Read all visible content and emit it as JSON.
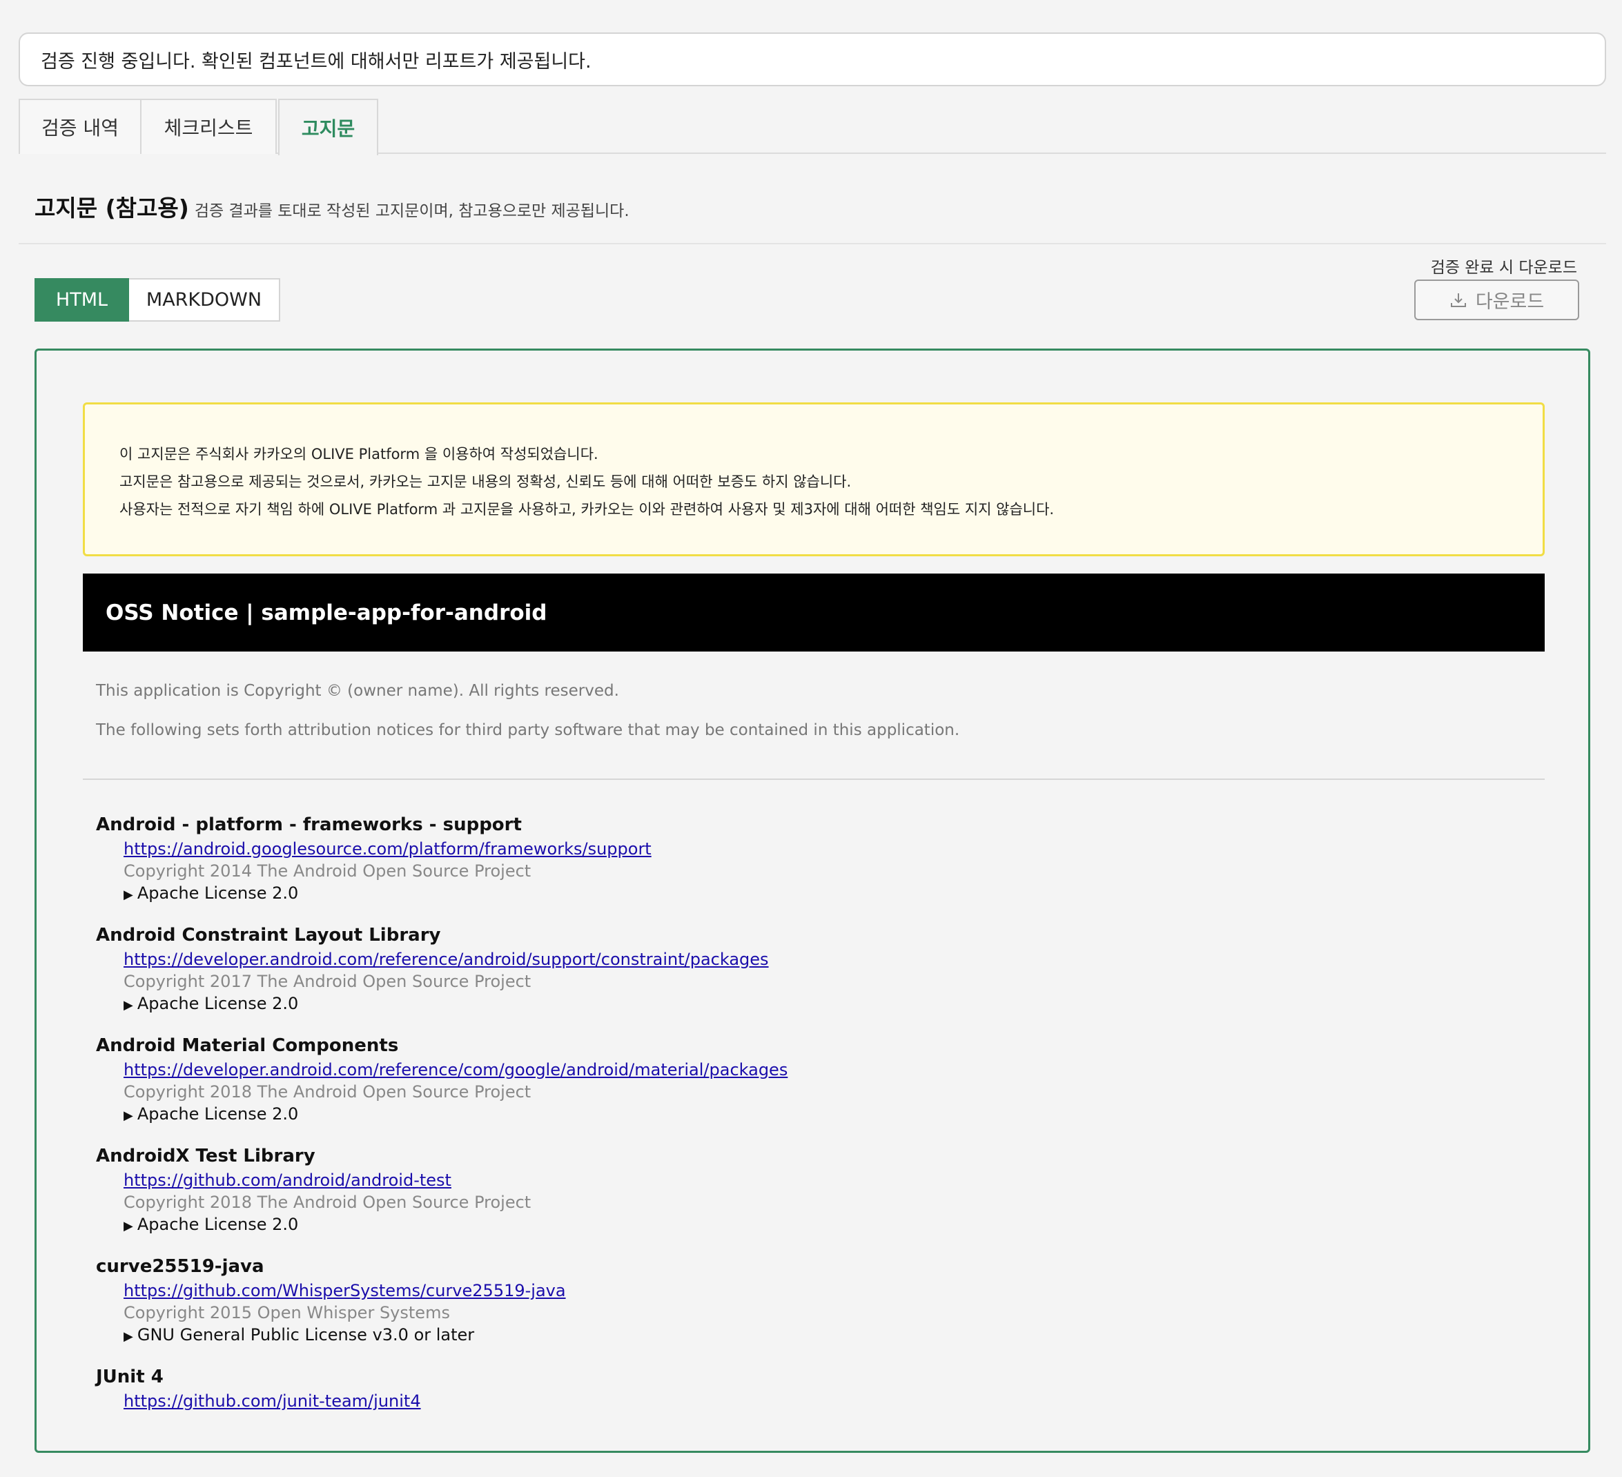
{
  "status": {
    "message": "검증 진행 중입니다. 확인된 컴포넌트에 대해서만 리포트가 제공됩니다."
  },
  "tabs": [
    {
      "label": "검증 내역"
    },
    {
      "label": "체크리스트"
    },
    {
      "label": "고지문",
      "active": true
    }
  ],
  "section": {
    "title": "고지문 (참고용)",
    "subtitle": "검증 결과를 토대로 작성된 고지문이며, 참고용으로만 제공됩니다."
  },
  "format": {
    "html_label": "HTML",
    "markdown_label": "MARKDOWN",
    "selected": "HTML"
  },
  "download": {
    "hint": "검증 완료 시 다운로드",
    "label": "다운로드",
    "icon": "download-icon"
  },
  "colors": {
    "accent": "#368a60",
    "link": "#1a0dab",
    "disclaimer_border": "#f1dd45",
    "banner_bg": "#000000"
  },
  "notice": {
    "disclaimer": [
      "이 고지문은 주식회사 카카오의 OLIVE Platform 을 이용하여 작성되었습니다.",
      "고지문은 참고용으로 제공되는 것으로서, 카카오는 고지문 내용의 정확성, 신뢰도 등에 대해 어떠한 보증도 하지 않습니다.",
      "사용자는 전적으로 자기 책임 하에 OLIVE Platform 과 고지문을 사용하고, 카카오는 이와 관련하여 사용자 및 제3자에 대해 어떠한 책임도 지지 않습니다."
    ],
    "banner_title": "OSS Notice | sample-app-for-android",
    "intro": [
      "This application is Copyright © (owner name). All rights reserved.",
      "The following sets forth attribution notices for third party software that may be contained in this application."
    ],
    "components": [
      {
        "name": "Android - platform - frameworks - support",
        "url": "https://android.googlesource.com/platform/frameworks/support",
        "copyright": "Copyright 2014 The Android Open Source Project",
        "license": "Apache License 2.0"
      },
      {
        "name": "Android Constraint Layout Library",
        "url": "https://developer.android.com/reference/android/support/constraint/packages",
        "copyright": "Copyright 2017 The Android Open Source Project",
        "license": "Apache License 2.0"
      },
      {
        "name": "Android Material Components",
        "url": "https://developer.android.com/reference/com/google/android/material/packages",
        "copyright": "Copyright 2018 The Android Open Source Project",
        "license": "Apache License 2.0"
      },
      {
        "name": "AndroidX Test Library",
        "url": "https://github.com/android/android-test",
        "copyright": "Copyright 2018 The Android Open Source Project",
        "license": "Apache License 2.0"
      },
      {
        "name": "curve25519-java",
        "url": "https://github.com/WhisperSystems/curve25519-java",
        "copyright": "Copyright 2015 Open Whisper Systems",
        "license": "GNU General Public License v3.0 or later"
      },
      {
        "name": "JUnit 4",
        "url": "https://github.com/junit-team/junit4",
        "copyright": "",
        "license": ""
      }
    ]
  }
}
